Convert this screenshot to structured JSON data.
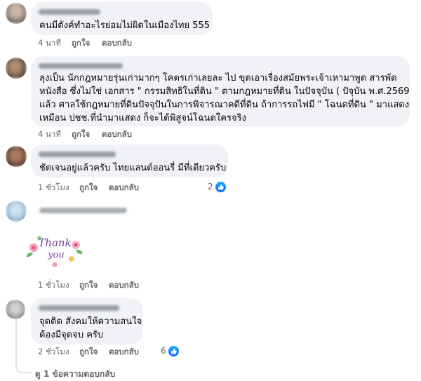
{
  "comments": [
    {
      "body": [
        "คนมีตังค์ทำอะไรย่อมไม่ผิดในเมืองไทย 555"
      ],
      "time": "4 นาที",
      "like": "ถูกใจ",
      "reply": "ตอบกลับ"
    },
    {
      "body": [
        "ลุงเป็น นักกฎหมายรุ่นเก่ามากๆ โคตรเก่าเลยละ ไป ขุดเอาเรื่องสมัยพระเจ้าเหามาพูด สารพัด",
        "หนังสือ ซึ่งไม่ใช่ เอกสาร \" กรรมสิทธิในที่ดิน \" ตามกฎหมายที่ดิน ในปัจจุบัน ( ปัจุบัน พ.ศ.2569",
        "แล้ว ศาลใช้กฎหมายที่ดินปัจจุปันในการพิจารณาคดีที่ดิน ถ้าการรถไฟมี \" โฉนดที่ดิน \" มาแสดง",
        "เหมือน ปชช.ที่นำมาแสดง ก็จะได้พิสูจน์โฉนดใครจริง"
      ],
      "time": "4 นาที",
      "like": "ถูกใจ",
      "reply": "ตอบกลับ"
    },
    {
      "body": [
        "ชัดเจนอยู่แล้วครับ ไทยแลนด์ออนรี่ มีที่เดียวครับ"
      ],
      "time": "1 ชั่วโมง",
      "like": "ถูกใจ",
      "reply": "ตอบกลับ",
      "reaction_count": "2"
    },
    {
      "sticker_text": "Thank you",
      "time": "1 ชั่วโมง",
      "like": "ถูกใจ",
      "reply": "ตอบกลับ"
    },
    {
      "body": [
        "จุดติด สังคมให้ความสนใจ",
        "ต้องมีจุดจบ ครับ"
      ],
      "time": "2 ชั่วโมง",
      "like": "ถูกใจ",
      "reply": "ตอบกลับ",
      "reaction_count": "6"
    }
  ],
  "more_replies": "ดู 1 ข้อความตอบกลับ",
  "colors": {
    "bubble": "#f0f2f5",
    "meta": "#65676b",
    "like_blue": "#0866ff"
  }
}
